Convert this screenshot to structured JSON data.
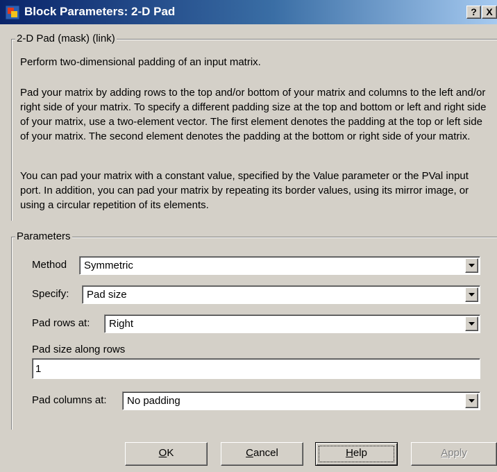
{
  "window": {
    "title": "Block Parameters: 2-D Pad",
    "help_glyph": "?",
    "close_glyph": "X"
  },
  "description": {
    "group_title": "2-D Pad (mask) (link)",
    "paragraph1": "Perform two-dimensional padding of an input matrix.",
    "paragraph2": "Pad your matrix by adding rows to the top and/or bottom of your matrix and columns to the left and/or right side of your matrix. To specify a different padding size at the top and bottom or left and right side of your matrix, use a two-element vector. The first element denotes the padding at the top or left side of your matrix. The second element denotes the padding at the bottom or right side of your matrix.",
    "paragraph3": "You can pad your matrix with a constant value, specified by the Value parameter or the PVal input port. In addition, you can pad your matrix by repeating its border values, using its mirror image, or using a circular repetition of its elements."
  },
  "parameters": {
    "group_title": "Parameters",
    "method": {
      "label": "Method",
      "value": "Symmetric"
    },
    "specify": {
      "label": "Specify:",
      "value": "Pad size"
    },
    "pad_rows_at": {
      "label": "Pad rows at:",
      "value": "Right"
    },
    "pad_size_along_rows": {
      "label": "Pad size along rows",
      "value": "1"
    },
    "pad_columns_at": {
      "label": "Pad columns at:",
      "value": "No padding"
    }
  },
  "buttons": {
    "ok": {
      "mnemonic": "O",
      "rest": "K"
    },
    "cancel": {
      "mnemonic": "C",
      "rest": "ancel"
    },
    "help": {
      "mnemonic": "H",
      "rest": "elp"
    },
    "apply": {
      "mnemonic": "A",
      "rest": "pply"
    }
  },
  "colors": {
    "titlebar_start": "#0a246a",
    "titlebar_end": "#a6caf0",
    "face": "#d4d0c8",
    "disabled_text": "#808080"
  },
  "icons": {
    "app": "simulink-block-icon",
    "dropdown": "chevron-down-icon"
  }
}
